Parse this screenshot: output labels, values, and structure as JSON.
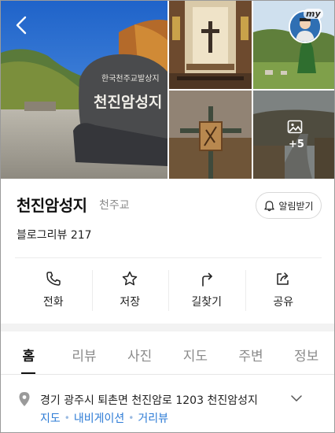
{
  "place": {
    "name": "천진암성지",
    "category": "천주교",
    "review_text": "블로그리뷰 217",
    "notify_label": "알림받기"
  },
  "gallery": {
    "stone_line1": "한국천주교발상지",
    "stone_line2": "천진암성지",
    "more_count": "+5",
    "my_label": "my"
  },
  "actions": [
    {
      "label": "전화",
      "icon": "phone-icon"
    },
    {
      "label": "저장",
      "icon": "star-icon"
    },
    {
      "label": "길찾기",
      "icon": "directions-icon"
    },
    {
      "label": "공유",
      "icon": "share-icon"
    }
  ],
  "tabs": [
    "홈",
    "리뷰",
    "사진",
    "지도",
    "주변",
    "정보"
  ],
  "active_tab": "홈",
  "address": {
    "text": "경기 광주시 퇴촌면 천진암로 1203 천진암성지",
    "links": [
      "지도",
      "내비게이션",
      "거리뷰"
    ]
  },
  "colors": {
    "link": "#2c7bd6",
    "muted": "#8a8a8a",
    "divider": "#ececec"
  }
}
